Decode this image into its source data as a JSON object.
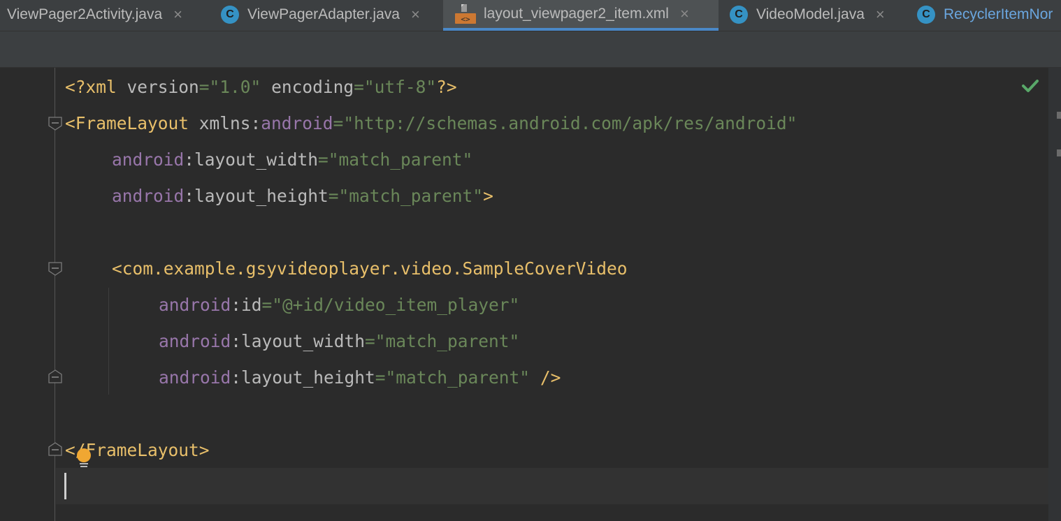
{
  "tabs": [
    {
      "label": "ViewPager2Activity.java",
      "close": "×",
      "icon": "none"
    },
    {
      "label": "ViewPagerAdapter.java",
      "close": "×",
      "icon": "class-icon",
      "icon_letter": "C"
    },
    {
      "label": "layout_viewpager2_item.xml",
      "close": "×",
      "icon": "xml-file-icon",
      "active": true
    },
    {
      "label": "VideoModel.java",
      "close": "×",
      "icon": "class-icon",
      "icon_letter": "C"
    },
    {
      "label": "RecyclerItemNor",
      "icon": "class-icon",
      "icon_letter": "C"
    }
  ],
  "code": {
    "l1": {
      "a": "<?xml ",
      "b": "version",
      "c": "=",
      "d": "\"1.0\"",
      "e": " encoding",
      "f": "=",
      "g": "\"utf-8\"",
      "h": "?>"
    },
    "l2": {
      "a": "<FrameLayout ",
      "b": "xmlns:",
      "c": "android",
      "d": "=",
      "e": "\"http://schemas.android.com/apk/res/android\""
    },
    "l3": {
      "a": "android",
      "b": ":layout_width",
      "c": "=",
      "d": "\"match_parent\""
    },
    "l4": {
      "a": "android",
      "b": ":layout_height",
      "c": "=",
      "d": "\"match_parent\"",
      "e": ">"
    },
    "l6": {
      "a": "<com.example.gsyvideoplayer.video.SampleCoverVideo"
    },
    "l7": {
      "a": "android",
      "b": ":id",
      "c": "=",
      "d": "\"@+id/video_item_player\""
    },
    "l8": {
      "a": "android",
      "b": ":layout_width",
      "c": "=",
      "d": "\"match_parent\""
    },
    "l9": {
      "a": "android",
      "b": ":layout_height",
      "c": "=",
      "d": "\"match_parent\"",
      "e": " />"
    },
    "l11": {
      "a": "</FrameLayout>"
    }
  },
  "colors": {
    "tag": "#e8bf6a",
    "namespace": "#9876aa",
    "attribute": "#bababa",
    "string": "#6a8759",
    "active_tab_underline": "#4a88c7",
    "inspection_ok": "#59a869"
  },
  "icons": {
    "inspection": "check-icon",
    "intention": "lightbulb-icon",
    "fold": "fold-marker-icon"
  }
}
